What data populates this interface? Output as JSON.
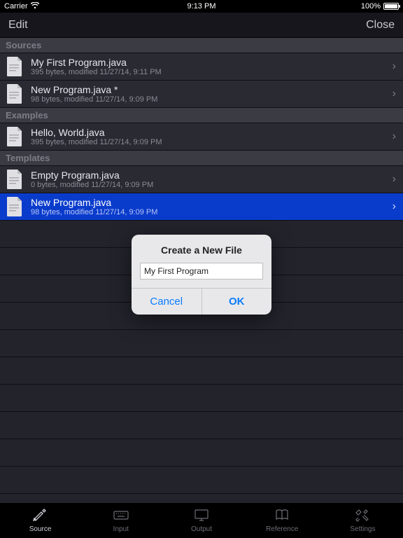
{
  "statusbar": {
    "carrier": "Carrier",
    "time": "9:13 PM",
    "battery": "100%"
  },
  "navbar": {
    "left": "Edit",
    "right": "Close"
  },
  "sections": {
    "sources": {
      "title": "Sources",
      "items": [
        {
          "title": "My First Program.java",
          "meta": "395 bytes, modified 11/27/14, 9:11 PM"
        },
        {
          "title": "New Program.java *",
          "meta": "98 bytes, modified 11/27/14, 9:09 PM"
        }
      ]
    },
    "examples": {
      "title": "Examples",
      "items": [
        {
          "title": "Hello, World.java",
          "meta": "395 bytes, modified 11/27/14, 9:09 PM"
        }
      ]
    },
    "templates": {
      "title": "Templates",
      "items": [
        {
          "title": "Empty Program.java",
          "meta": "0 bytes, modified 11/27/14, 9:09 PM"
        },
        {
          "title": "New Program.java",
          "meta": "98 bytes, modified 11/27/14, 9:09 PM",
          "selected": true
        }
      ]
    }
  },
  "tabs": [
    {
      "label": "Source",
      "icon": "pen-icon",
      "active": true
    },
    {
      "label": "Input",
      "icon": "keyboard-icon",
      "active": false
    },
    {
      "label": "Output",
      "icon": "monitor-icon",
      "active": false
    },
    {
      "label": "Reference",
      "icon": "book-icon",
      "active": false
    },
    {
      "label": "Settings",
      "icon": "tools-icon",
      "active": false
    }
  ],
  "dialog": {
    "title": "Create a New File",
    "input_value": "My First Program",
    "cancel": "Cancel",
    "ok": "OK"
  }
}
